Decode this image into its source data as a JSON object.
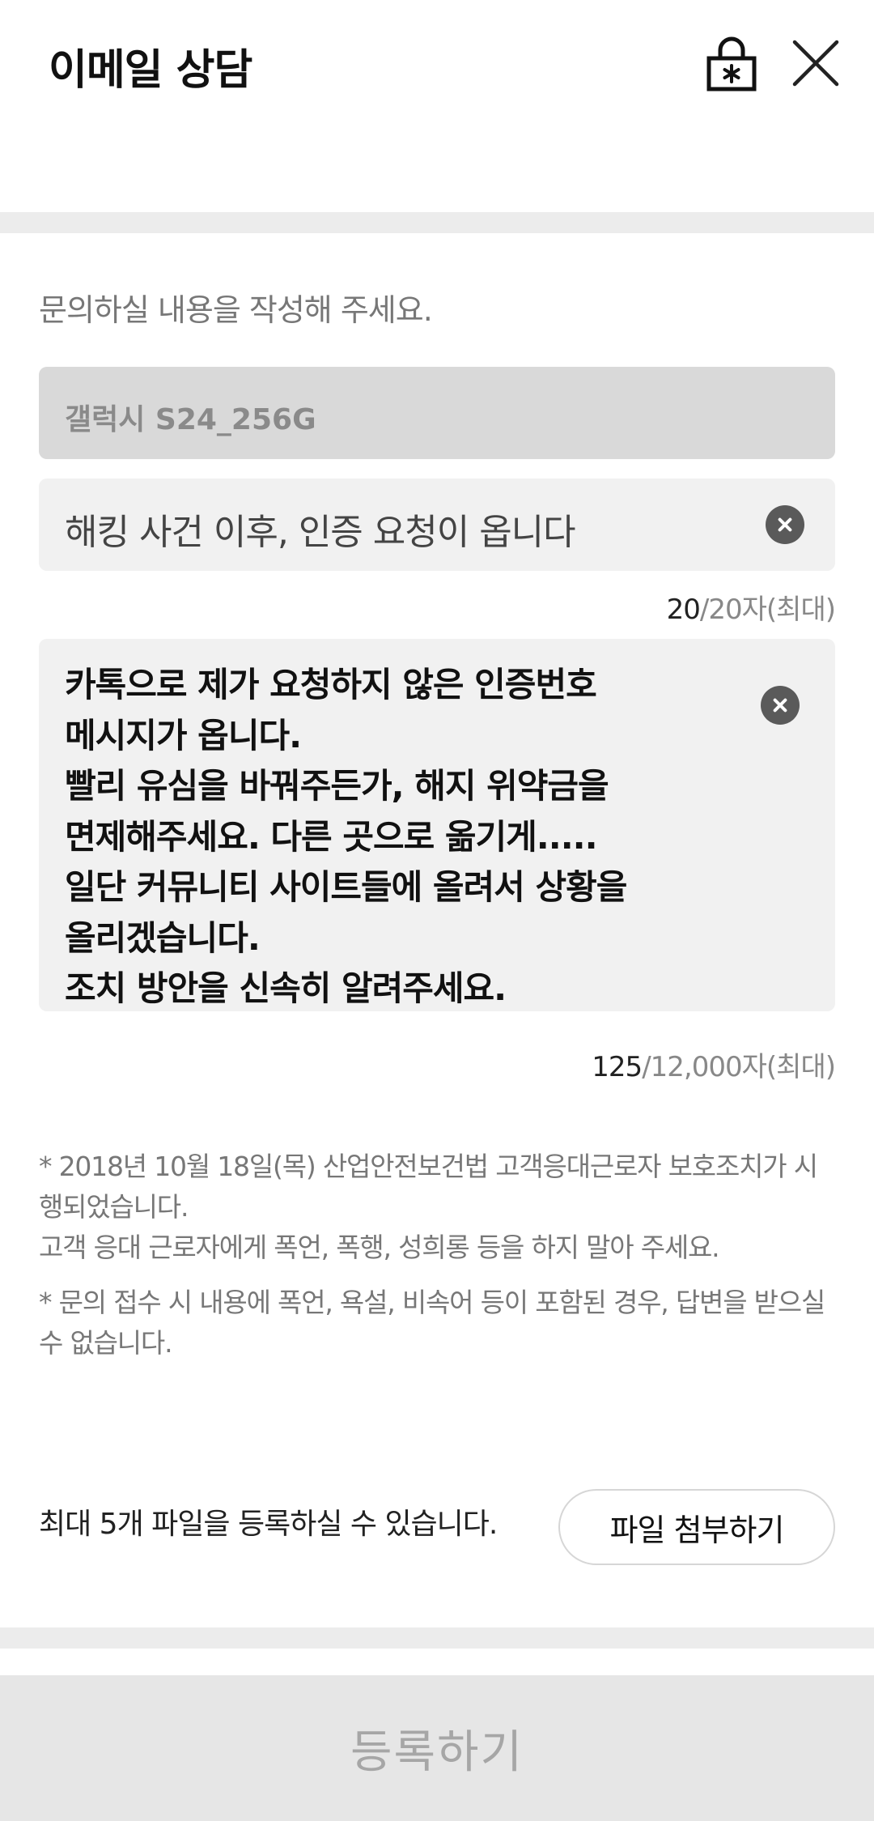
{
  "header": {
    "title": "이메일 상담",
    "icons": {
      "lock": "lock-icon",
      "close": "close-icon"
    }
  },
  "form": {
    "prompt": "문의하실 내용을 작성해 주세요.",
    "device": {
      "value": "갤럭시 S24_256G"
    },
    "subject": {
      "value": "해킹 사건 이후, 인증 요청이 옵니다",
      "count": "20",
      "limit": "/20자(최대)"
    },
    "body": {
      "value": "카톡으로 제가 요청하지 않은 인증번호\n메시지가 옵니다.\n빨리 유심을 바꿔주든가, 해지 위약금을\n면제해주세요. 다른 곳으로 옮기게.....\n일단 커뮤니티 사이트들에 올려서 상황을\n올리겠습니다.\n조치 방안을 신속히 알려주세요.",
      "count": "125",
      "limit": "/12,000자(최대)"
    }
  },
  "notices": [
    "* 2018년 10월 18일(목) 산업안전보건법 고객응대근로자 보호조치가 시행되었습니다.\n고객 응대 근로자에게 폭언, 폭행, 성희롱 등을 하지 말아 주세요.",
    "* 문의 접수 시 내용에 폭언, 욕설, 비속어 등이 포함된 경우, 답변을 받으실 수 없습니다."
  ],
  "attachment": {
    "info": "최대 5개 파일을 등록하실 수 있습니다.",
    "button_label": "파일 첨부하기"
  },
  "submit": {
    "label": "등록하기"
  },
  "colors": {
    "disabled_bg": "#e6e6e6",
    "input_bg": "#f1f1f1",
    "readonly_bg": "#d9d9d9"
  }
}
